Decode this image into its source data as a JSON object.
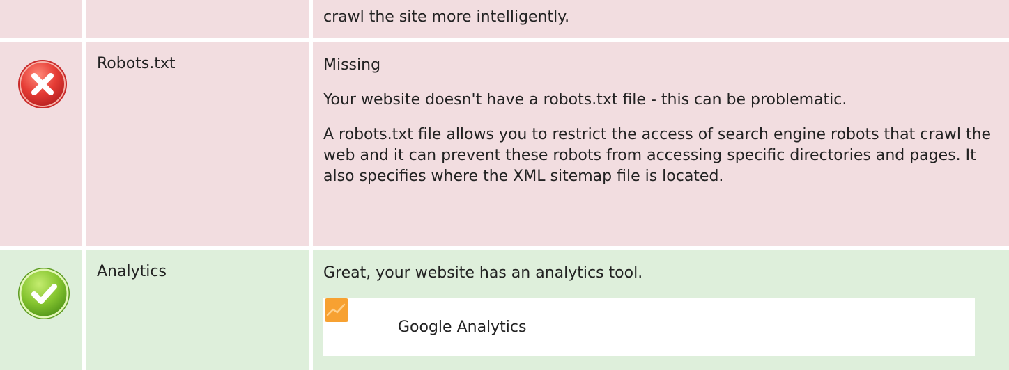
{
  "rows": [
    {
      "status": "fail",
      "status_icon": "x-circle-icon",
      "label": "",
      "paragraphs": [
        "crawl the site more intelligently."
      ]
    },
    {
      "status": "fail",
      "status_icon": "x-circle-icon",
      "label": "Robots.txt",
      "paragraphs": [
        "Missing",
        "Your website doesn't have a robots.txt file - this can be problematic.",
        "A robots.txt file allows you to restrict the access of search engine robots that crawl the web and it can prevent these robots from accessing specific directories and pages. It also specifies where the XML sitemap file is located."
      ]
    },
    {
      "status": "pass",
      "status_icon": "check-circle-icon",
      "label": "Analytics",
      "paragraphs": [
        "Great, your website has an analytics tool."
      ],
      "tools": [
        {
          "name": "Google Analytics",
          "icon": "google-analytics-icon"
        }
      ]
    }
  ],
  "colors": {
    "fail_bg": "#f2dde0",
    "pass_bg": "#deefdb",
    "fail_icon": "#e03a3a",
    "pass_icon": "#7cc12e",
    "ga_orange": "#f7a131"
  }
}
